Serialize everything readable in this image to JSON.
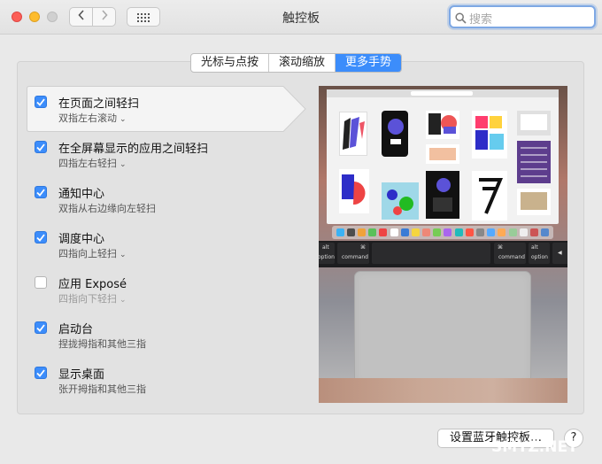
{
  "window": {
    "title": "触控板"
  },
  "search": {
    "placeholder": "搜索"
  },
  "tabs": [
    {
      "label": "光标与点按",
      "active": false
    },
    {
      "label": "滚动缩放",
      "active": false
    },
    {
      "label": "更多手势",
      "active": true
    }
  ],
  "gestures": [
    {
      "label": "在页面之间轻扫",
      "detail": "双指左右滚动",
      "checked": true,
      "has_menu": true
    },
    {
      "label": "在全屏幕显示的应用之间轻扫",
      "detail": "四指左右轻扫",
      "checked": true,
      "has_menu": true
    },
    {
      "label": "通知中心",
      "detail": "双指从右边缘向左轻扫",
      "checked": true,
      "has_menu": false
    },
    {
      "label": "调度中心",
      "detail": "四指向上轻扫",
      "checked": true,
      "has_menu": true
    },
    {
      "label": "应用 Exposé",
      "detail": "四指向下轻扫",
      "checked": false,
      "has_menu": true
    },
    {
      "label": "启动台",
      "detail": "捏拢拇指和其他三指",
      "checked": true,
      "has_menu": false
    },
    {
      "label": "显示桌面",
      "detail": "张开拇指和其他三指",
      "checked": true,
      "has_menu": false
    }
  ],
  "preview": {
    "keys": {
      "alt": "alt",
      "option": "option",
      "command": "command",
      "cmd_symbol": "⌘"
    }
  },
  "footer": {
    "setup_button": "设置蓝牙触控板…",
    "help_button": "?"
  },
  "watermark": {
    "text": "SMYZ.NET",
    "logo": "值 什么值得买"
  },
  "colors": {
    "accent": "#3c8dfb"
  }
}
